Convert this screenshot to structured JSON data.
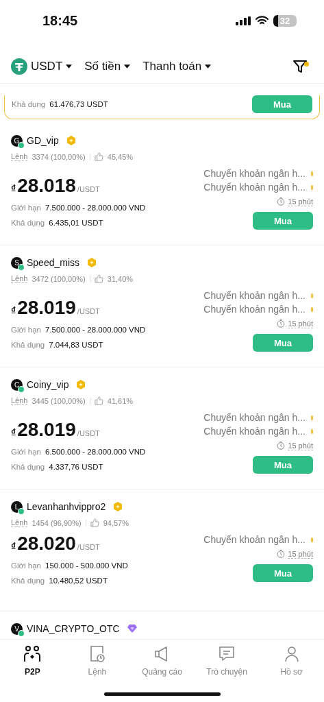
{
  "status_bar": {
    "time": "18:45",
    "battery": "32"
  },
  "filters": [
    {
      "kind": "coin",
      "label": "USDT"
    },
    {
      "kind": "plain",
      "label": "Số tiền"
    },
    {
      "kind": "plain",
      "label": "Thanh toán"
    }
  ],
  "filter_active": true,
  "partial_offer": {
    "available_label": "Khả dụng",
    "available": "61.476,73 USDT",
    "button": "Mua"
  },
  "offers": [
    {
      "initial": "G",
      "online": true,
      "name": "GD_vip",
      "badge": {
        "kind": "gold"
      },
      "orders_label": "Lệnh",
      "orders": "3374 (100,00%)",
      "rating": "45,45%",
      "currency": "₫",
      "price": "28.018",
      "unit": "/USDT",
      "payments": [
        "Chuyển khoản ngân h...",
        "Chuyển khoản ngân h..."
      ],
      "time": "15 phút",
      "limit_label": "Giới hạn",
      "limit": "7.500.000 - 28.000.000 VND",
      "available_label": "Khả dụng",
      "available": "6.435,01 USDT",
      "button": "Mua"
    },
    {
      "initial": "S",
      "online": true,
      "name": "Speed_miss",
      "badge": {
        "kind": "gold"
      },
      "orders_label": "Lệnh",
      "orders": "3472 (100,00%)",
      "rating": "31,40%",
      "currency": "₫",
      "price": "28.019",
      "unit": "/USDT",
      "payments": [
        "Chuyển khoản ngân h...",
        "Chuyển khoản ngân h..."
      ],
      "time": "15 phút",
      "limit_label": "Giới hạn",
      "limit": "7.500.000 - 28.000.000 VND",
      "available_label": "Khả dụng",
      "available": "7.044,83 USDT",
      "button": "Mua"
    },
    {
      "initial": "C",
      "online": true,
      "name": "Coiny_vip",
      "badge": {
        "kind": "gold"
      },
      "orders_label": "Lệnh",
      "orders": "3445 (100,00%)",
      "rating": "41,61%",
      "currency": "₫",
      "price": "28.019",
      "unit": "/USDT",
      "payments": [
        "Chuyển khoản ngân h...",
        "Chuyển khoản ngân h..."
      ],
      "time": "15 phút",
      "limit_label": "Giới hạn",
      "limit": "6.500.000 - 28.000.000 VND",
      "available_label": "Khả dụng",
      "available": "4.337,76 USDT",
      "button": "Mua"
    },
    {
      "initial": "L",
      "online": true,
      "name": "Levanhanhvippro2",
      "badge": {
        "kind": "gold"
      },
      "orders_label": "Lệnh",
      "orders": "1454 (96,90%)",
      "rating": "94,57%",
      "currency": "₫",
      "price": "28.020",
      "unit": "/USDT",
      "payments": [
        "Chuyển khoản ngân h..."
      ],
      "time": "15 phút",
      "limit_label": "Giới hạn",
      "limit": "150.000 - 500.000 VND",
      "available_label": "Khả dụng",
      "available": "10.480,52 USDT",
      "button": "Mua"
    }
  ],
  "partial_user": {
    "initial": "V",
    "online": true,
    "name": "VINA_CRYPTO_OTC",
    "badge": {
      "kind": "diamond"
    }
  },
  "nav": [
    {
      "kind": "p2p",
      "label": "P2P",
      "selected": true
    },
    {
      "kind": "orders",
      "label": "Lệnh",
      "selected": false
    },
    {
      "kind": "ads",
      "label": "Quảng cáo",
      "selected": false
    },
    {
      "kind": "chat",
      "label": "Trò chuyện",
      "selected": false
    },
    {
      "kind": "profile",
      "label": "Hồ sơ",
      "selected": false
    }
  ]
}
